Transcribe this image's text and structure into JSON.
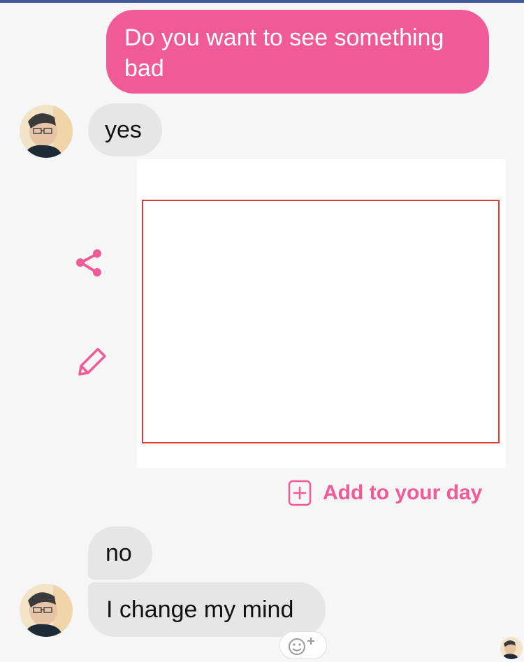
{
  "messages": {
    "outgoing_1": "Do you want to see something bad",
    "incoming_1": "yes",
    "incoming_2": "no",
    "incoming_3": "I change my mind"
  },
  "media_actions": {
    "share_icon": "share-icon",
    "edit_icon": "pencil-icon"
  },
  "add_to_day": {
    "label": "Add to your day",
    "icon": "plus-box-icon"
  },
  "reaction": {
    "icon": "smiley-add-icon"
  },
  "colors": {
    "accent": "#f05a96",
    "incoming_bubble": "#e6e6e6",
    "background": "#f6f6f6",
    "media_border": "#e03a3a"
  }
}
